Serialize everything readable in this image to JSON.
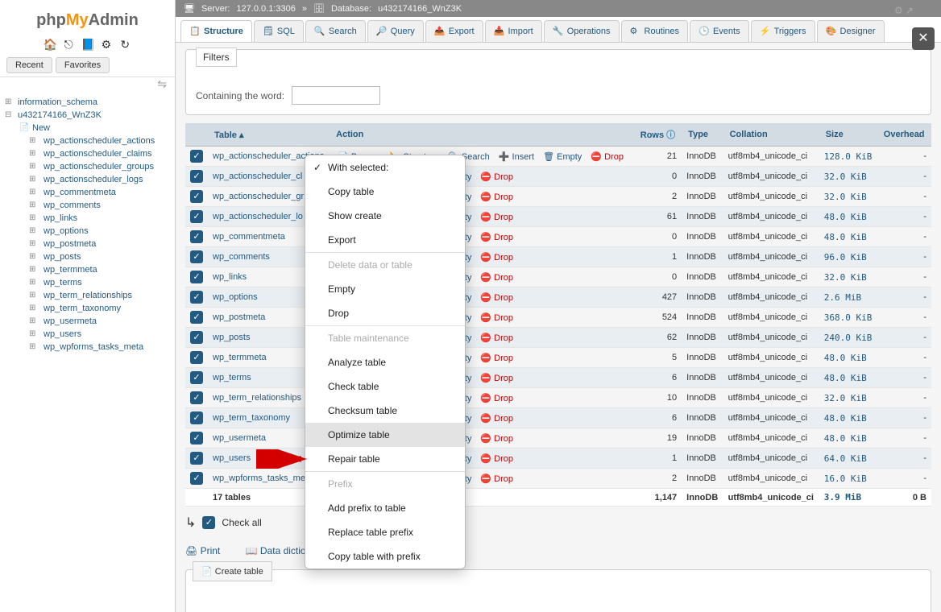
{
  "logo": {
    "php": "php",
    "my": "My",
    "admin": "Admin"
  },
  "sidebar": {
    "tabs": {
      "recent": "Recent",
      "favorites": "Favorites"
    },
    "databases": [
      {
        "name": "information_schema",
        "open": false
      },
      {
        "name": "u432174166_WnZ3K",
        "open": true
      }
    ],
    "new_label": "New",
    "tables": [
      "wp_actionscheduler_actions",
      "wp_actionscheduler_claims",
      "wp_actionscheduler_groups",
      "wp_actionscheduler_logs",
      "wp_commentmeta",
      "wp_comments",
      "wp_links",
      "wp_options",
      "wp_postmeta",
      "wp_posts",
      "wp_termmeta",
      "wp_terms",
      "wp_term_relationships",
      "wp_term_taxonomy",
      "wp_usermeta",
      "wp_users",
      "wp_wpforms_tasks_meta"
    ]
  },
  "breadcrumb": {
    "server_label": "Server:",
    "server": "127.0.0.1:3306",
    "db_label": "Database:",
    "db": "u432174166_WnZ3K"
  },
  "tabs": [
    "Structure",
    "SQL",
    "Search",
    "Query",
    "Export",
    "Import",
    "Operations",
    "Routines",
    "Events",
    "Triggers",
    "Designer"
  ],
  "active_tab": 0,
  "filters": {
    "title": "Filters",
    "label": "Containing the word:",
    "value": ""
  },
  "columns": {
    "table": "Table",
    "action": "Action",
    "rows": "Rows",
    "type": "Type",
    "collation": "Collation",
    "size": "Size",
    "overhead": "Overhead"
  },
  "row_actions": {
    "browse": "Browse",
    "structure": "Structure",
    "search": "Search",
    "insert": "Insert",
    "empty": "Empty",
    "drop": "Drop"
  },
  "rows": [
    {
      "name": "wp_actionscheduler_actions",
      "rows": 21,
      "type": "InnoDB",
      "collation": "utf8mb4_unicode_ci",
      "size": "128.0 KiB",
      "overhead": "-"
    },
    {
      "name": "wp_actionscheduler_cl",
      "rows": 0,
      "type": "InnoDB",
      "collation": "utf8mb4_unicode_ci",
      "size": "32.0 KiB",
      "overhead": "-"
    },
    {
      "name": "wp_actionscheduler_gr",
      "rows": 2,
      "type": "InnoDB",
      "collation": "utf8mb4_unicode_ci",
      "size": "32.0 KiB",
      "overhead": "-"
    },
    {
      "name": "wp_actionscheduler_lo",
      "rows": 61,
      "type": "InnoDB",
      "collation": "utf8mb4_unicode_ci",
      "size": "48.0 KiB",
      "overhead": "-"
    },
    {
      "name": "wp_commentmeta",
      "rows": 0,
      "type": "InnoDB",
      "collation": "utf8mb4_unicode_ci",
      "size": "48.0 KiB",
      "overhead": "-"
    },
    {
      "name": "wp_comments",
      "rows": 1,
      "type": "InnoDB",
      "collation": "utf8mb4_unicode_ci",
      "size": "96.0 KiB",
      "overhead": "-"
    },
    {
      "name": "wp_links",
      "rows": 0,
      "type": "InnoDB",
      "collation": "utf8mb4_unicode_ci",
      "size": "32.0 KiB",
      "overhead": "-"
    },
    {
      "name": "wp_options",
      "rows": 427,
      "type": "InnoDB",
      "collation": "utf8mb4_unicode_ci",
      "size": "2.6 MiB",
      "overhead": "-"
    },
    {
      "name": "wp_postmeta",
      "rows": 524,
      "type": "InnoDB",
      "collation": "utf8mb4_unicode_ci",
      "size": "368.0 KiB",
      "overhead": "-"
    },
    {
      "name": "wp_posts",
      "rows": 62,
      "type": "InnoDB",
      "collation": "utf8mb4_unicode_ci",
      "size": "240.0 KiB",
      "overhead": "-"
    },
    {
      "name": "wp_termmeta",
      "rows": 5,
      "type": "InnoDB",
      "collation": "utf8mb4_unicode_ci",
      "size": "48.0 KiB",
      "overhead": "-"
    },
    {
      "name": "wp_terms",
      "rows": 6,
      "type": "InnoDB",
      "collation": "utf8mb4_unicode_ci",
      "size": "48.0 KiB",
      "overhead": "-"
    },
    {
      "name": "wp_term_relationships",
      "rows": 10,
      "type": "InnoDB",
      "collation": "utf8mb4_unicode_ci",
      "size": "32.0 KiB",
      "overhead": "-"
    },
    {
      "name": "wp_term_taxonomy",
      "rows": 6,
      "type": "InnoDB",
      "collation": "utf8mb4_unicode_ci",
      "size": "48.0 KiB",
      "overhead": "-"
    },
    {
      "name": "wp_usermeta",
      "rows": 19,
      "type": "InnoDB",
      "collation": "utf8mb4_unicode_ci",
      "size": "48.0 KiB",
      "overhead": "-"
    },
    {
      "name": "wp_users",
      "rows": 1,
      "type": "InnoDB",
      "collation": "utf8mb4_unicode_ci",
      "size": "64.0 KiB",
      "overhead": "-"
    },
    {
      "name": "wp_wpforms_tasks_me",
      "rows": 2,
      "type": "InnoDB",
      "collation": "utf8mb4_unicode_ci",
      "size": "16.0 KiB",
      "overhead": "-"
    }
  ],
  "summary": {
    "count": "17 tables",
    "rows": "1,147",
    "type": "InnoDB",
    "collation": "utf8mb4_unicode_ci",
    "size": "3.9 MiB",
    "overhead": "0 B"
  },
  "check_all": "Check all",
  "bottom": {
    "print": "Print",
    "dict": "Data dictionary",
    "create": "Create table"
  },
  "ctx": {
    "header": "With selected:",
    "items": [
      {
        "t": "Copy table",
        "e": true
      },
      {
        "t": "Show create",
        "e": true
      },
      {
        "t": "Export",
        "e": true
      },
      {
        "t": "Delete data or table",
        "e": false
      },
      {
        "t": "Empty",
        "e": true
      },
      {
        "t": "Drop",
        "e": true
      },
      {
        "t": "Table maintenance",
        "e": false
      },
      {
        "t": "Analyze table",
        "e": true
      },
      {
        "t": "Check table",
        "e": true
      },
      {
        "t": "Checksum table",
        "e": true
      },
      {
        "t": "Optimize table",
        "e": true,
        "hl": true
      },
      {
        "t": "Repair table",
        "e": true
      },
      {
        "t": "Prefix",
        "e": false
      },
      {
        "t": "Add prefix to table",
        "e": true
      },
      {
        "t": "Replace table prefix",
        "e": true
      },
      {
        "t": "Copy table with prefix",
        "e": true
      }
    ]
  }
}
